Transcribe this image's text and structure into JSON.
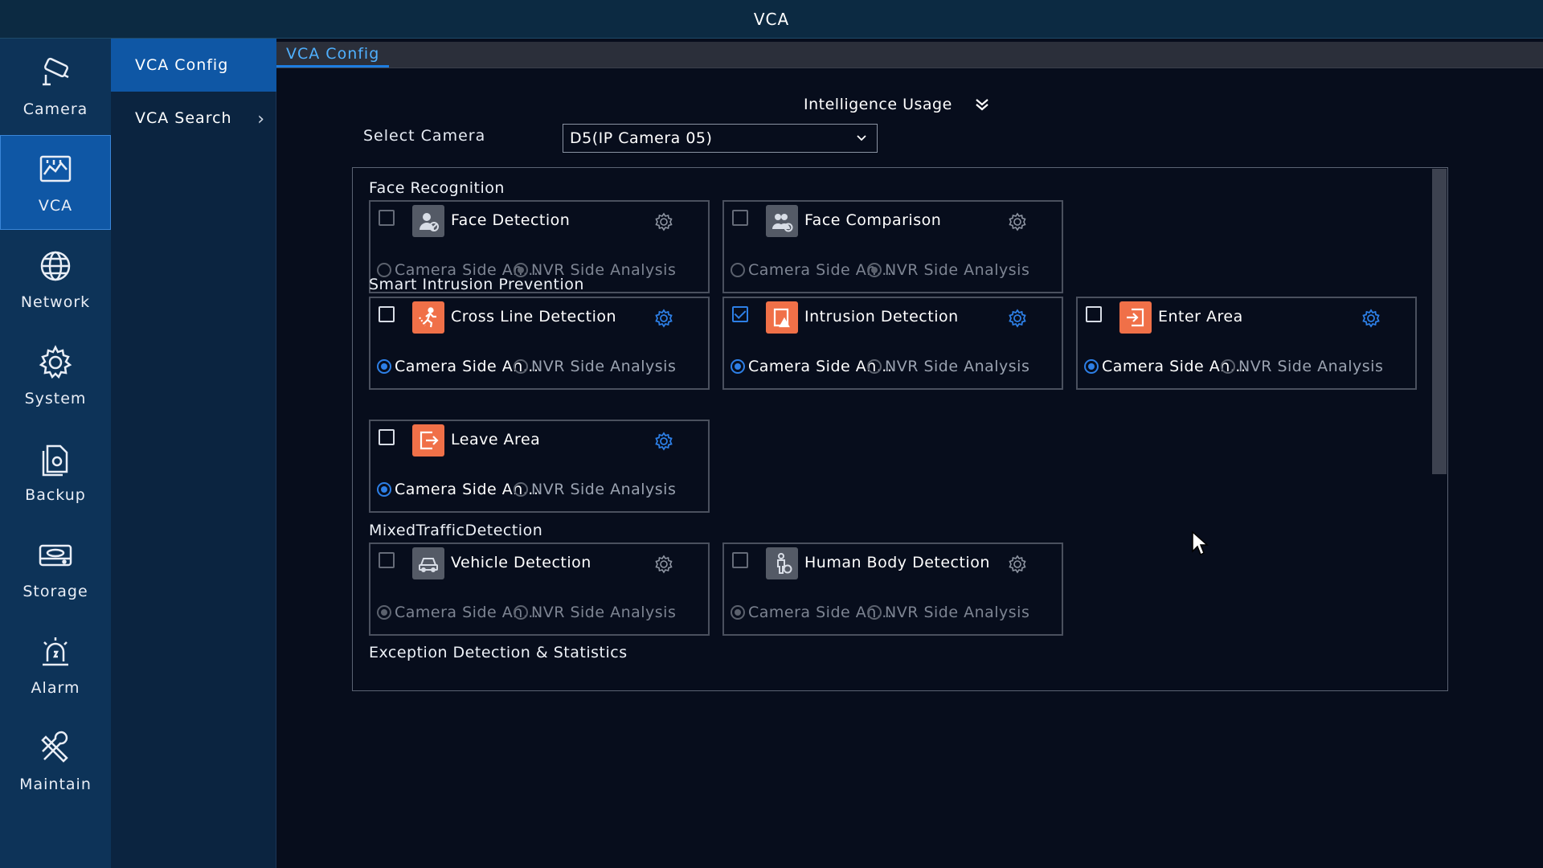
{
  "window": {
    "title": "VCA"
  },
  "nav": [
    {
      "label": "Camera",
      "icon": "camera-icon",
      "active": false
    },
    {
      "label": "VCA",
      "icon": "vca-icon",
      "active": true
    },
    {
      "label": "Network",
      "icon": "network-icon",
      "active": false
    },
    {
      "label": "System",
      "icon": "gear-icon",
      "active": false
    },
    {
      "label": "Backup",
      "icon": "backup-icon",
      "active": false
    },
    {
      "label": "Storage",
      "icon": "storage-icon",
      "active": false
    },
    {
      "label": "Alarm",
      "icon": "alarm-icon",
      "active": false
    },
    {
      "label": "Maintain",
      "icon": "tools-icon",
      "active": false
    }
  ],
  "submenu": [
    {
      "label": "VCA Config",
      "active": true
    },
    {
      "label": "VCA Search",
      "active": false,
      "chevron": "›"
    }
  ],
  "tab": {
    "label": "VCA Config"
  },
  "content": {
    "usage_label": "Intelligence Usage",
    "select_camera_label": "Select Camera",
    "select_camera_value": "D5(IP Camera 05)"
  },
  "sections": {
    "face": "Face Recognition",
    "intrusion": "Smart Intrusion Prevention",
    "traffic": "MixedTrafficDetection",
    "exception": "Exception Detection & Statistics"
  },
  "cards": {
    "face_detection": {
      "label": "Face Detection",
      "camera": "Camera Side An...",
      "nvr": "NVR Side Analysis"
    },
    "face_comparison": {
      "label": "Face Comparison",
      "camera": "Camera Side An...",
      "nvr": "NVR Side Analysis"
    },
    "cross_line": {
      "label": "Cross Line Detection",
      "camera": "Camera Side An...",
      "nvr": "NVR Side Analysis"
    },
    "intrusion": {
      "label": "Intrusion Detection",
      "camera": "Camera Side An...",
      "nvr": "NVR Side Analysis"
    },
    "enter_area": {
      "label": "Enter Area",
      "camera": "Camera Side An...",
      "nvr": "NVR Side Analysis"
    },
    "leave_area": {
      "label": "Leave Area",
      "camera": "Camera Side An...",
      "nvr": "NVR Side Analysis"
    },
    "vehicle": {
      "label": "Vehicle Detection",
      "camera": "Camera Side An...",
      "nvr": "NVR Side Analysis"
    },
    "human_body": {
      "label": "Human Body Detection",
      "camera": "Camera Side An...",
      "nvr": "NVR Side Analysis"
    }
  },
  "colors": {
    "accent": "#2d7fe6",
    "nav_bg": "#0d3358",
    "nav_active": "#0f57a5",
    "feature_orange": "#f07048"
  }
}
